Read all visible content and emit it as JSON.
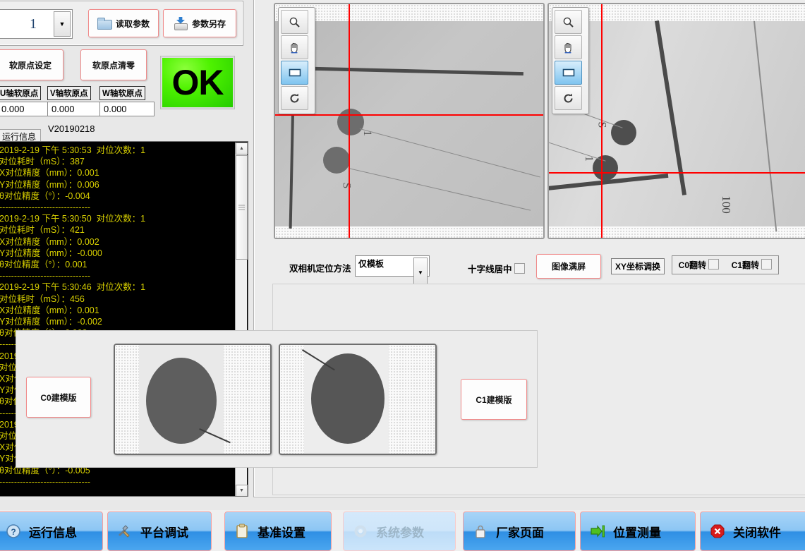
{
  "top": {
    "recipe_value": "1",
    "dropdown_icon": "chevron-down-icon",
    "read_params_label": "读取参数",
    "read_params_icon": "open-folder-icon",
    "save_params_label": "参数另存",
    "save_params_icon": "save-disk-icon",
    "set_soft_origin_label": "软原点设定",
    "clear_soft_origin_label": "软原点清零",
    "status_lamp": "OK",
    "version": "V20190218",
    "axes": [
      {
        "label": "U轴软原点",
        "value": "0.000"
      },
      {
        "label": "V轴软原点",
        "value": "0.000"
      },
      {
        "label": "W轴软原点",
        "value": "0.000"
      }
    ]
  },
  "log": {
    "tab_label": "运行信息",
    "text": "2019-2-19 下午 5:30:53  对位次数：1\n对位耗时（mS）：387\nX对位精度（mm）：0.001\nY对位精度（mm）：0.006\nθ对位精度（°）：-0.004\n-------------------------------\n2019-2-19 下午 5:30:50  对位次数：1\n对位耗时（mS）：421\nX对位精度（mm）：0.002\nY对位精度（mm）：-0.000\nθ对位精度（°）：0.001\n-------------------------------\n2019-2-19 下午 5:30:46  对位次数：1\n对位耗时（mS）：456\nX对位精度（mm）：0.001\nY对位精度（mm）：-0.002\nθ对位精度（°）：0.002\n-------------------------------\n2019-2-19 下午 5:30:42  对位次数：1\n对位耗时（mS）：462\nX对位精度（mm）：-0.007\nY对位精度（mm）：-0.003\nθ对位精度（°）：-0.001\n-------------------------------\n2019-2-19 上午 11:26:33  对位次数：2\n对位耗时（mS）：686\nX对位精度（mm）：-0.001\nY对位精度（mm）：-0.010\nθ对位精度（°）：-0.005\n-------------------------------"
  },
  "viewer": {
    "tools": [
      {
        "name": "zoom-icon",
        "glyph": "🔍",
        "selected": false
      },
      {
        "name": "pan-hand-icon",
        "glyph": "✋",
        "selected": false
      },
      {
        "name": "rectangle-select-icon",
        "glyph": "▭",
        "selected": true
      },
      {
        "name": "rotate-refresh-icon",
        "glyph": "↻",
        "selected": false
      }
    ],
    "camera0_marks": [
      "1",
      "S"
    ],
    "camera1_marks": [
      "S",
      "1",
      "100"
    ]
  },
  "controls": {
    "method_label": "双相机定位方法",
    "method_value": "仅模板",
    "method_arrow_icon": "chevron-down-icon",
    "crosshair_center_label": "十字线居中",
    "crosshair_center_checked": false,
    "fullscreen_label": "图像满屏",
    "xy_swap_label": "XY坐标调换",
    "flip_c0_label": "C0翻转",
    "flip_c0_checked": false,
    "flip_c1_label": "C1翻转",
    "flip_c1_checked": false
  },
  "templates": {
    "c0_button": "C0建模版",
    "c1_button": "C1建模版"
  },
  "taskbar": [
    {
      "label": "运行信息",
      "icon": "help-circle-icon",
      "glyph": "?",
      "disabled": false
    },
    {
      "label": "平台调试",
      "icon": "tools-wrench-icon",
      "glyph": "🛠",
      "disabled": false
    },
    {
      "label": "基准设置",
      "icon": "clipboard-icon",
      "glyph": "📋",
      "disabled": false
    },
    {
      "label": "系统参数",
      "icon": "gear-icon",
      "glyph": "⚙",
      "disabled": true
    },
    {
      "label": "厂家页面",
      "icon": "lock-icon",
      "glyph": "🔒",
      "disabled": false
    },
    {
      "label": "位置测量",
      "icon": "arrow-into-bar-icon",
      "glyph": "⇥",
      "disabled": false
    },
    {
      "label": "关闭软件",
      "icon": "close-octagon-icon",
      "glyph": "✕",
      "disabled": false
    }
  ],
  "colors": {
    "accent_red": "#f08a8a",
    "lamp_green": "#4ef200",
    "log_text": "#d9d100",
    "taskbar_blue": "#2f8fe4"
  }
}
